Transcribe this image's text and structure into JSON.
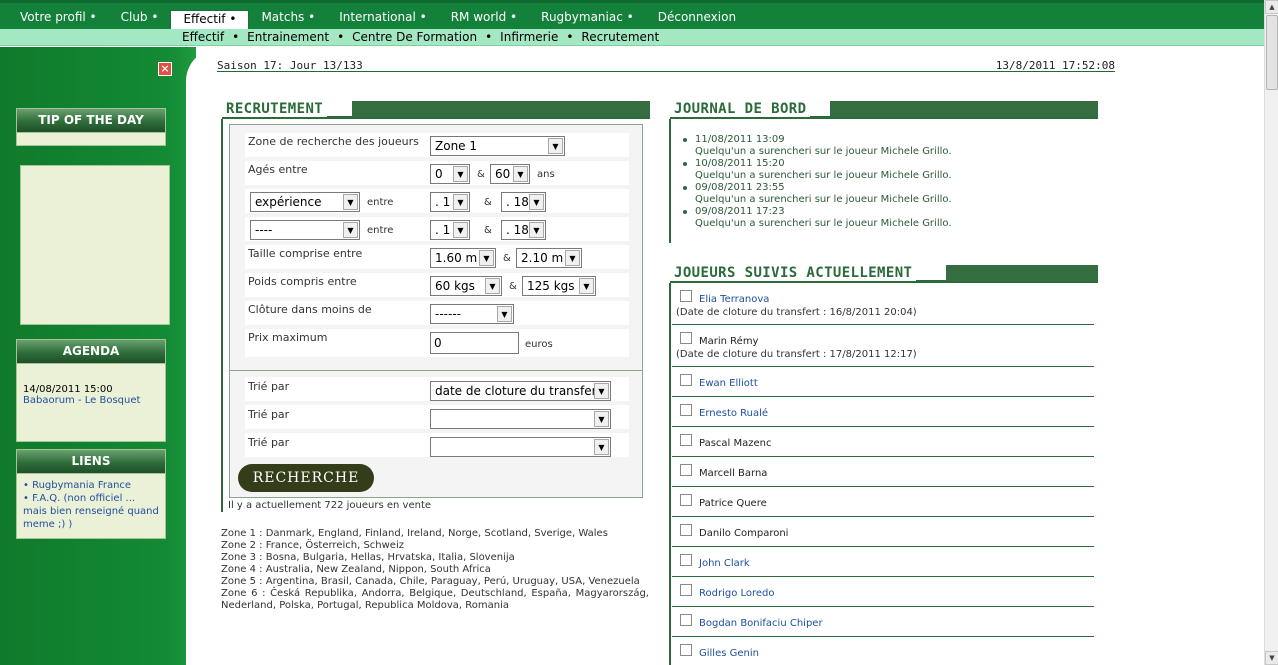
{
  "main_menu": [
    {
      "label": "Votre profil •",
      "active": false
    },
    {
      "label": "Club •",
      "active": false
    },
    {
      "label": "Effectif •",
      "active": true
    },
    {
      "label": "Matchs •",
      "active": false
    },
    {
      "label": "International •",
      "active": false
    },
    {
      "label": "RM world •",
      "active": false
    },
    {
      "label": "Rugbymaniac •",
      "active": false
    },
    {
      "label": "Déconnexion",
      "active": false
    }
  ],
  "sub_menu": [
    "Effectif",
    "Entrainement",
    "Centre De Formation",
    "Infirmerie",
    "Recrutement"
  ],
  "sub_menu_separator": "•",
  "sidebar": {
    "tip_title": "TIP OF THE DAY",
    "agenda_title": "AGENDA",
    "agenda_date": "14/08/2011 15:00",
    "agenda_event": "Babaorum - Le Bosquet",
    "liens_title": "LIENS",
    "links": [
      "• Rugbymania France",
      "• F.A.Q. (non officiel ... mais bien renseigné quand meme ;) )"
    ]
  },
  "header": {
    "season": "Saison 17: Jour 13/133",
    "datetime": "13/8/2011 17:52:08"
  },
  "recrutement": {
    "title": "RECRUTEMENT",
    "zone_label": "Zone de recherche des joueurs",
    "zone_value": "Zone 1",
    "age_label": "Agés entre",
    "age_min": "0",
    "age_max": "60",
    "age_unit": "ans",
    "amp": "&",
    "between": "entre",
    "crit1_value": "expérience",
    "crit1_min": ". 1",
    "crit1_max": ". 18",
    "crit2_value": "----",
    "crit2_min": ". 1",
    "crit2_max": ". 18",
    "height_label": "Taille comprise entre",
    "height_min": "1.60 m",
    "height_max": "2.10 m",
    "weight_label": "Poids compris entre",
    "weight_min": "60 kgs",
    "weight_max": "125 kgs",
    "closing_label": "Clôture dans moins de",
    "closing_value": "------",
    "price_label": "Prix maximum",
    "price_value": "0",
    "price_unit": "euros",
    "sort_label": "Trié par",
    "sort1_value": "date de cloture du transfert",
    "sort2_value": "",
    "sort3_value": "",
    "search_button": "RECHERCHE",
    "count_note": "Il y a actuellement 722 joueurs en vente",
    "zones": [
      "Zone 1 : Danmark, England, Finland, Ireland, Norge, Scotland, Sverige, Wales",
      "Zone 2 : France, Österreich, Schweiz",
      "Zone 3 : Bosna, Bulgaria, Hellas, Hrvatska, Italia, Slovenija",
      "Zone 4 : Australia, New Zealand, Nippon, South Africa",
      "Zone 5 : Argentina, Brasil, Canada, Chile, Paraguay, Perú, Uruguay, USA, Venezuela",
      "Zone 6 : Česká Republika, Andorra, Belgique, Deutschland, España, Magyarország, Nederland, Polska, Portugal, Republica Moldova, Romania"
    ]
  },
  "journal": {
    "title": "JOURNAL DE BORD",
    "entries": [
      {
        "date": "11/08/2011 13:09",
        "text": "Quelqu'un a surencheri sur le joueur Michele Grillo."
      },
      {
        "date": "10/08/2011 15:20",
        "text": "Quelqu'un a surencheri sur le joueur Michele Grillo."
      },
      {
        "date": "09/08/2011 23:55",
        "text": "Quelqu'un a surencheri sur le joueur Michele Grillo."
      },
      {
        "date": "09/08/2011 17:23",
        "text": "Quelqu'un a surencheri sur le joueur Michele Grillo."
      }
    ]
  },
  "suivis": {
    "title": "JOUEURS SUIVIS ACTUELLEMENT",
    "players": [
      {
        "name": "Elia Terranova",
        "link": true,
        "note": "(Date de cloture du transfert : 16/8/2011 20:04)"
      },
      {
        "name": "Marin Rémy",
        "link": false,
        "note": "(Date de cloture du transfert : 17/8/2011 12:17)"
      },
      {
        "name": "Ewan Elliott",
        "link": true,
        "note": ""
      },
      {
        "name": "Ernesto Rualé",
        "link": true,
        "note": ""
      },
      {
        "name": "Pascal Mazenc",
        "link": false,
        "note": ""
      },
      {
        "name": "Marcell Barna",
        "link": false,
        "note": ""
      },
      {
        "name": "Patrice Quere",
        "link": false,
        "note": ""
      },
      {
        "name": "Danilo Comparoni",
        "link": false,
        "note": ""
      },
      {
        "name": "John Clark",
        "link": true,
        "note": ""
      },
      {
        "name": "Rodrigo Loredo",
        "link": true,
        "note": ""
      },
      {
        "name": "Bogdan Bonifaciu Chiper",
        "link": true,
        "note": ""
      },
      {
        "name": "Gilles Genin",
        "link": true,
        "note": ""
      }
    ]
  }
}
